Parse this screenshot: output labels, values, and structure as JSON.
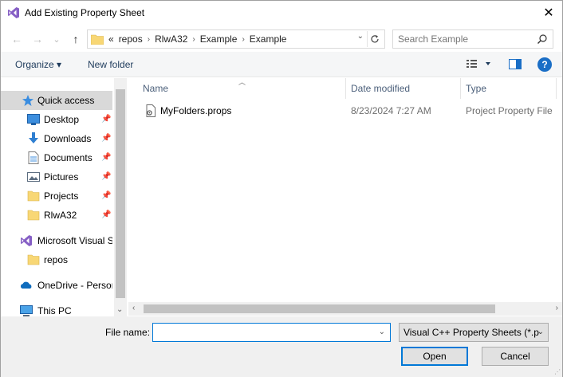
{
  "window": {
    "title": "Add Existing Property Sheet",
    "close_glyph": "✕"
  },
  "nav": {
    "back_glyph": "←",
    "forward_glyph": "→",
    "recent_glyph": "⌄",
    "up_glyph": "↑",
    "overflow": "«",
    "breadcrumbs": [
      "repos",
      "RlwA32",
      "Example",
      "Example"
    ],
    "search_placeholder": "Search Example"
  },
  "toolbar": {
    "organize": "Organize ▾",
    "new_folder": "New folder",
    "help": "?"
  },
  "sidebar": {
    "items": [
      {
        "label": "Quick access",
        "icon": "star-icon",
        "pinned": false
      },
      {
        "label": "Desktop",
        "icon": "desktop-icon",
        "pinned": true
      },
      {
        "label": "Downloads",
        "icon": "download-icon",
        "pinned": true
      },
      {
        "label": "Documents",
        "icon": "documents-icon",
        "pinned": true
      },
      {
        "label": "Pictures",
        "icon": "pictures-icon",
        "pinned": true
      },
      {
        "label": "Projects",
        "icon": "folder-icon",
        "pinned": true
      },
      {
        "label": "RlwA32",
        "icon": "folder-icon",
        "pinned": true
      },
      {
        "label": "Microsoft Visual S",
        "icon": "visual-studio-icon",
        "pinned": false
      },
      {
        "label": "repos",
        "icon": "folder-icon",
        "pinned": false
      },
      {
        "label": "OneDrive - Persor",
        "icon": "onedrive-icon",
        "pinned": false
      },
      {
        "label": "This PC",
        "icon": "pc-icon",
        "pinned": false
      }
    ]
  },
  "files": {
    "columns": {
      "name": "Name",
      "date": "Date modified",
      "type": "Type"
    },
    "rows": [
      {
        "name": "MyFolders.props",
        "date": "8/23/2024 7:27 AM",
        "type": "Project Property File"
      }
    ]
  },
  "bottom": {
    "file_name_label": "File name:",
    "file_name_value": "",
    "filter": "Visual C++ Property Sheets (*.p",
    "open": "Open",
    "cancel": "Cancel"
  },
  "colors": {
    "accent": "#0078d7",
    "selected": "#d9d9d9",
    "vs_purple": "#865fc5",
    "folder_yellow": "#f8d775"
  }
}
